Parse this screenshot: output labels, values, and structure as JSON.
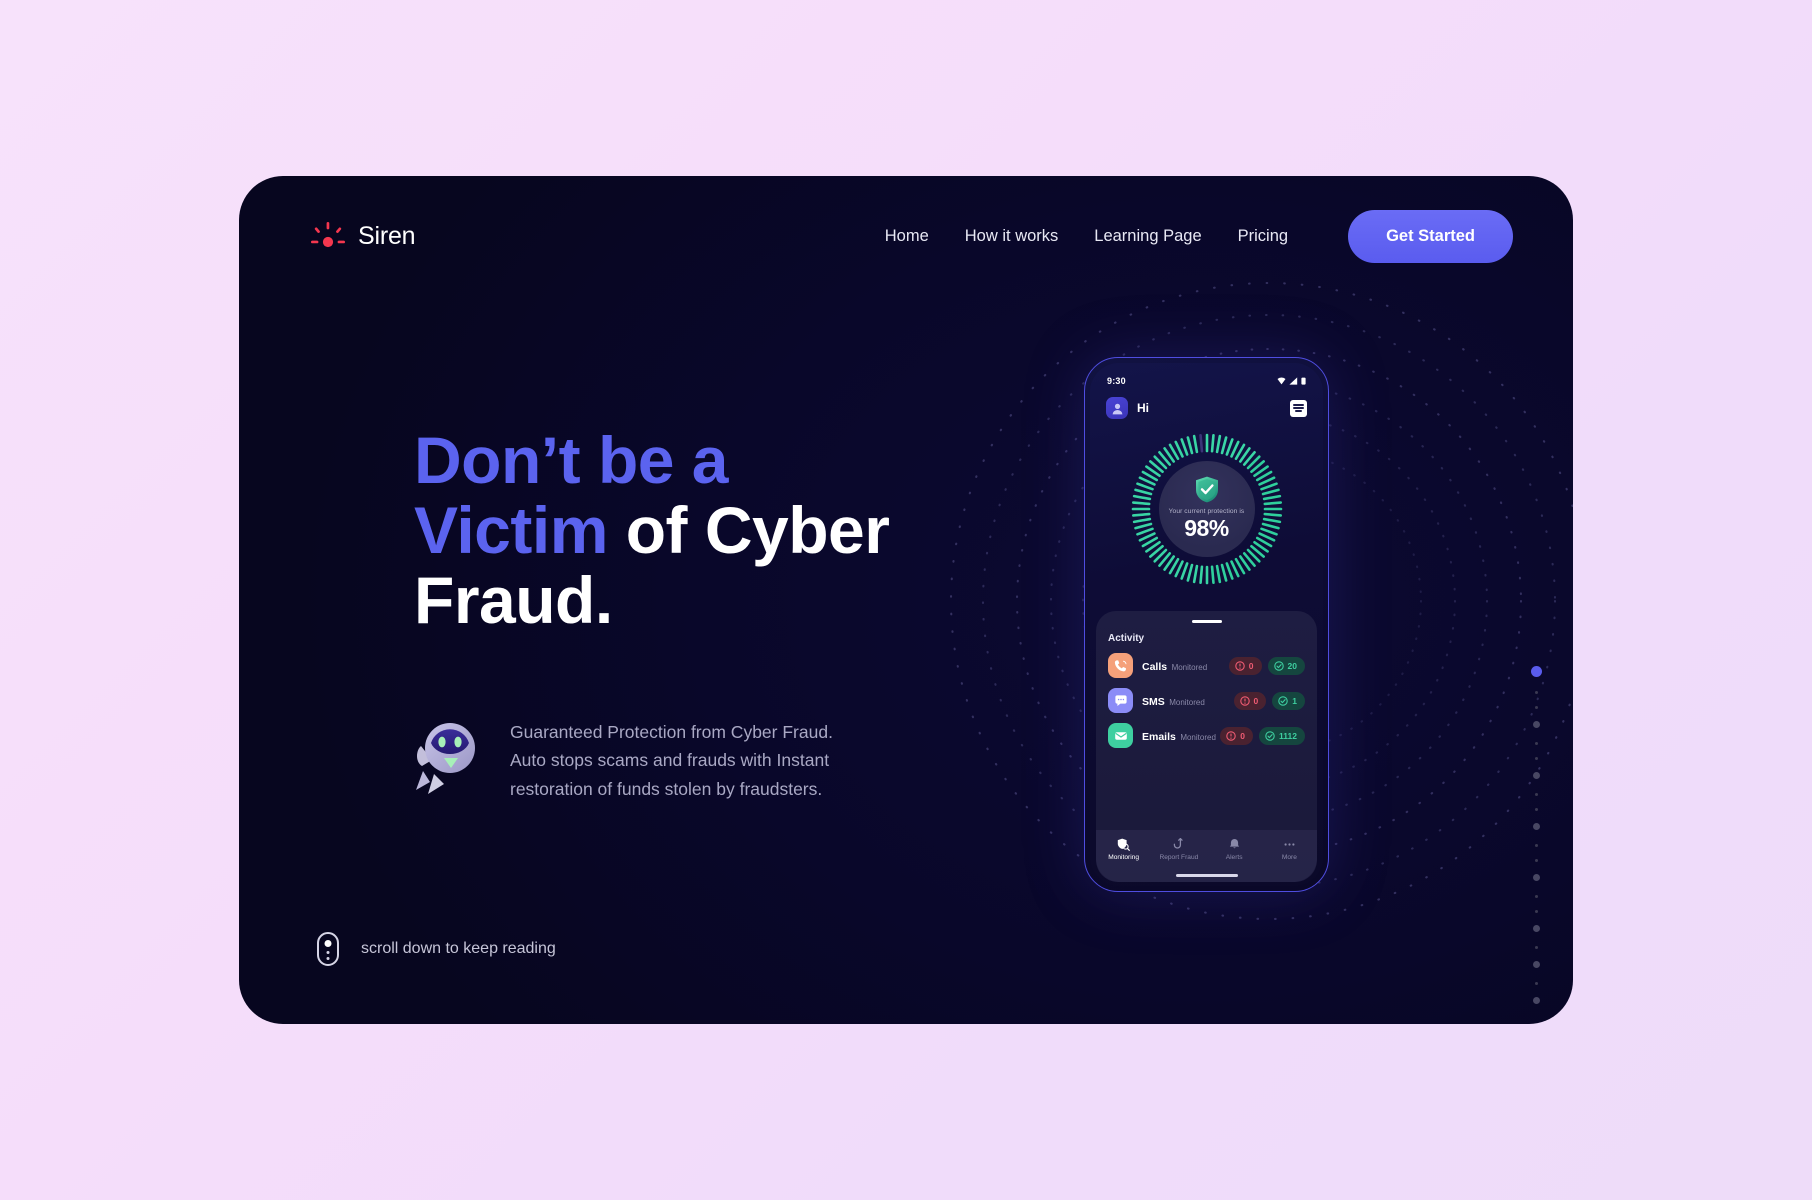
{
  "theme": {
    "page_bg": "#f5ddfa",
    "panel_bg": "#09072a",
    "accent_indigo": "#5b63ef",
    "accent_red": "#f4374f",
    "accent_green": "#3ecfa0",
    "accent_orange": "#f5a07a"
  },
  "header": {
    "brand_name": "Siren",
    "nav_items": [
      {
        "label": "Home"
      },
      {
        "label": "How it works"
      },
      {
        "label": "Learning Page"
      },
      {
        "label": "Pricing"
      }
    ],
    "cta_label": "Get Started"
  },
  "hero": {
    "headline_line1_accent": "Don’t be a",
    "headline_line2_accent": "Victim",
    "headline_line2_rest": " of Cyber",
    "headline_line3": "Fraud.",
    "paragraph_line1": "Guaranteed Protection from Cyber Fraud.",
    "paragraph_line2": "Auto stops scams and frauds with Instant",
    "paragraph_line3": "restoration of funds stolen by fraudsters."
  },
  "scroll_hint": {
    "label": "scroll down to keep reading"
  },
  "scroll_dots": {
    "active_index": 0,
    "pattern": [
      "active",
      "sm",
      "sm",
      "md",
      "sm",
      "sm",
      "md",
      "sm",
      "sm",
      "md",
      "sm",
      "sm",
      "md",
      "sm",
      "sm",
      "md",
      "sm",
      "md",
      "sm",
      "md"
    ]
  },
  "phone": {
    "status": {
      "time": "9:30",
      "icons": [
        "wifi-icon",
        "signal-icon",
        "battery-icon"
      ]
    },
    "app_header": {
      "avatar_icon": "user-avatar-icon",
      "greeting": "Hi",
      "menu_icon": "document-list-icon"
    },
    "gauge": {
      "caption": "Your current protection is",
      "value": "98%",
      "percent": 98,
      "shield_icon": "shield-check-icon"
    },
    "activity": {
      "title": "Activity",
      "rows": [
        {
          "name": "Calls",
          "status": "Monitored",
          "icon": "phone-call-icon",
          "icon_color": "#f5a07a",
          "alert_count": "0",
          "safe_count": "20"
        },
        {
          "name": "SMS",
          "status": "Monitored",
          "icon": "chat-bubble-icon",
          "icon_color": "#8b8cf7",
          "alert_count": "0",
          "safe_count": "1"
        },
        {
          "name": "Emails",
          "status": "Monitored",
          "icon": "envelope-icon",
          "icon_color": "#3ecfa0",
          "alert_count": "0",
          "safe_count": "1112"
        }
      ]
    },
    "bottom_nav": [
      {
        "label": "Monitoring",
        "icon": "monitoring-icon",
        "active": true
      },
      {
        "label": "Report Fraud",
        "icon": "fish-hook-icon",
        "active": false
      },
      {
        "label": "Alerts",
        "icon": "bell-icon",
        "active": false
      },
      {
        "label": "More",
        "icon": "more-dots-icon",
        "active": false
      }
    ]
  }
}
